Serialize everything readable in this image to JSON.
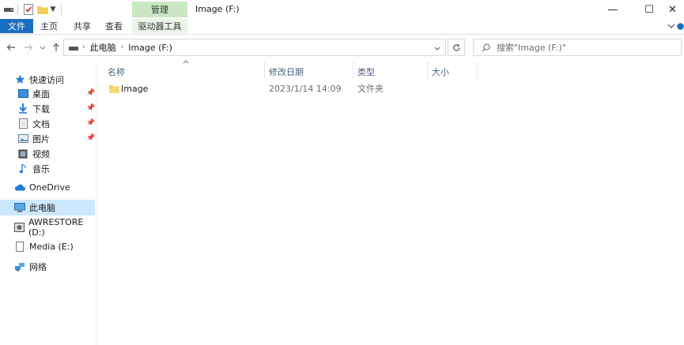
{
  "window": {
    "title": "Image (F:)",
    "contextual_tab": "管理",
    "minimize_glyph": "—",
    "maximize_glyph": "☐",
    "close_glyph": "✕"
  },
  "ribbon": {
    "tabs": [
      "文件",
      "主页",
      "共享",
      "查看",
      "驱动器工具"
    ]
  },
  "address": {
    "segments": [
      "此电脑",
      "Image (F:)"
    ],
    "search_placeholder": "搜索\"Image (F:)\""
  },
  "nav_pane": {
    "quick_access": "快速访问",
    "quick_items": [
      "桌面",
      "下载",
      "文档",
      "图片",
      "视频",
      "音乐"
    ],
    "onedrive": "OneDrive",
    "this_pc": "此电脑",
    "drive_d": "AWRESTORE (D:)",
    "drive_e": "Media (E:)",
    "network": "网络"
  },
  "columns": {
    "name": "名称",
    "date": "修改日期",
    "type": "类型",
    "size": "大小"
  },
  "files": [
    {
      "name": "Image",
      "date": "2023/1/14 14:09",
      "type": "文件夹",
      "size": ""
    }
  ],
  "colors": {
    "file_tab": "#1a6ec0",
    "context_tab": "#c9e8c3",
    "selected_nav": "#cce8ff",
    "header_text": "#4d6082",
    "folder": "#f6cf57"
  }
}
